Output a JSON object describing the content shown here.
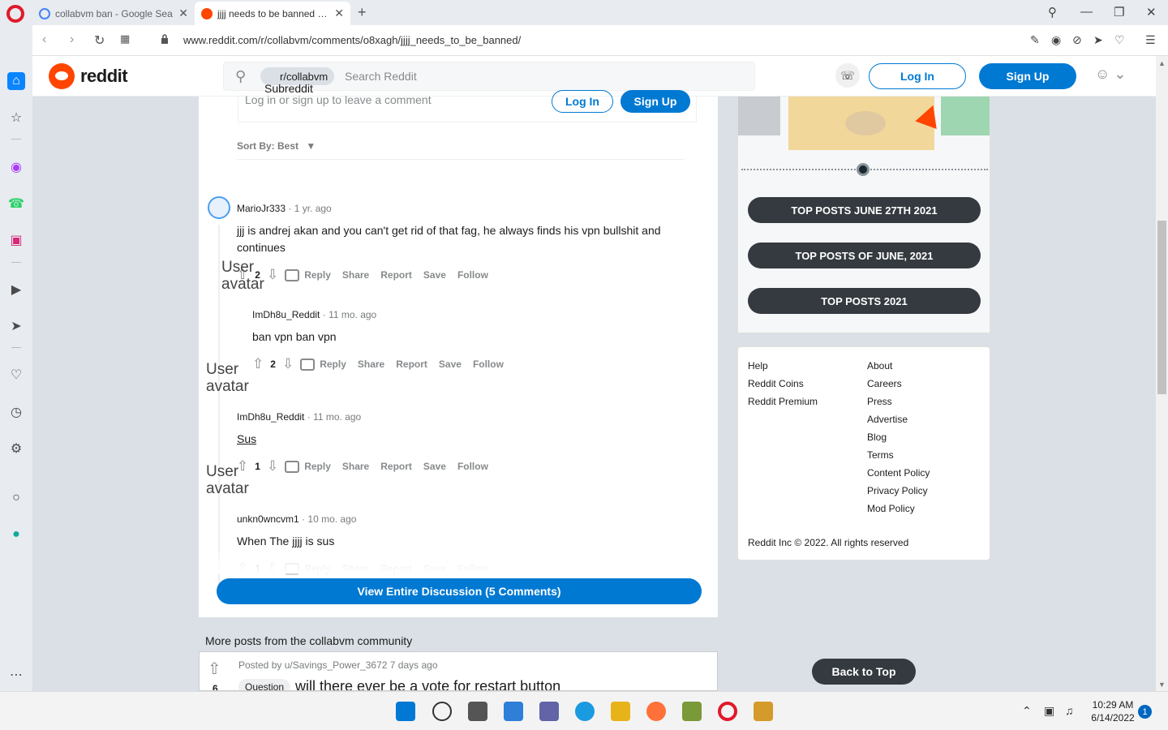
{
  "browser": {
    "tabs": [
      {
        "title": "collabvm ban - Google Sea",
        "favicon": "google-icon"
      },
      {
        "title": "jjjj needs to be banned : co",
        "favicon": "reddit-icon"
      }
    ],
    "url": "www.reddit.com/r/collabvm/comments/o8xagh/jjjj_needs_to_be_banned/",
    "new_tab": "+",
    "close_tab": "✕"
  },
  "header": {
    "logo_text": "reddit",
    "search_chip": "r/collabvm",
    "subreddit_alt": "Subreddit Icon",
    "search_placeholder": "Search Reddit",
    "login_label": "Log In",
    "signup_label": "Sign Up"
  },
  "comment_prompt": {
    "text": "Log in or sign up to leave a comment",
    "login_label": "Log In",
    "signup_label": "Sign Up"
  },
  "sort_label": "Sort By: Best",
  "avatar_alt": "User avatar",
  "actions": {
    "reply": "Reply",
    "share": "Share",
    "report": "Report",
    "save": "Save",
    "follow": "Follow"
  },
  "comments": [
    {
      "author": "MarioJr333",
      "time": "1 yr. ago",
      "body": "jjj is andrej akan and you can't get rid of that fag, he always finds his vpn bullshit and continues",
      "score": "2"
    },
    {
      "author": "ImDh8u_Reddit",
      "time": "11 mo. ago",
      "body": "ban vpn ban vpn",
      "score": "2"
    },
    {
      "author": "ImDh8u_Reddit",
      "time": "11 mo. ago",
      "body": "Sus",
      "score": "1"
    },
    {
      "author": "unkn0wncvm1",
      "time": "10 mo. ago",
      "body": "When The jjjj is sus",
      "score": "1"
    }
  ],
  "view_all_label": "View Entire Discussion (5 Comments)",
  "more_posts": {
    "heading": "More posts from the collabvm community",
    "meta": "Posted by u/Savings_Power_3672 7 days ago",
    "score": "6",
    "flair": "Question",
    "title": "will there ever be a vote for restart button"
  },
  "sidebar": {
    "top_posts": [
      "TOP POSTS JUNE 27TH 2021",
      "TOP POSTS OF JUNE, 2021",
      "TOP POSTS 2021"
    ],
    "footer_left": [
      "Help",
      "Reddit Coins",
      "Reddit Premium"
    ],
    "footer_right": [
      "About",
      "Careers",
      "Press",
      "Advertise",
      "Blog",
      "Terms",
      "Content Policy",
      "Privacy Policy",
      "Mod Policy"
    ],
    "copyright": "Reddit Inc © 2022. All rights reserved",
    "back_to_top": "Back to Top"
  },
  "taskbar": {
    "time": "10:29 AM",
    "date": "6/14/2022",
    "notifications": "1"
  },
  "colors": {
    "reddit_orange": "#ff4500",
    "reddit_blue": "#0079d3",
    "dark_button": "#343a3f"
  }
}
